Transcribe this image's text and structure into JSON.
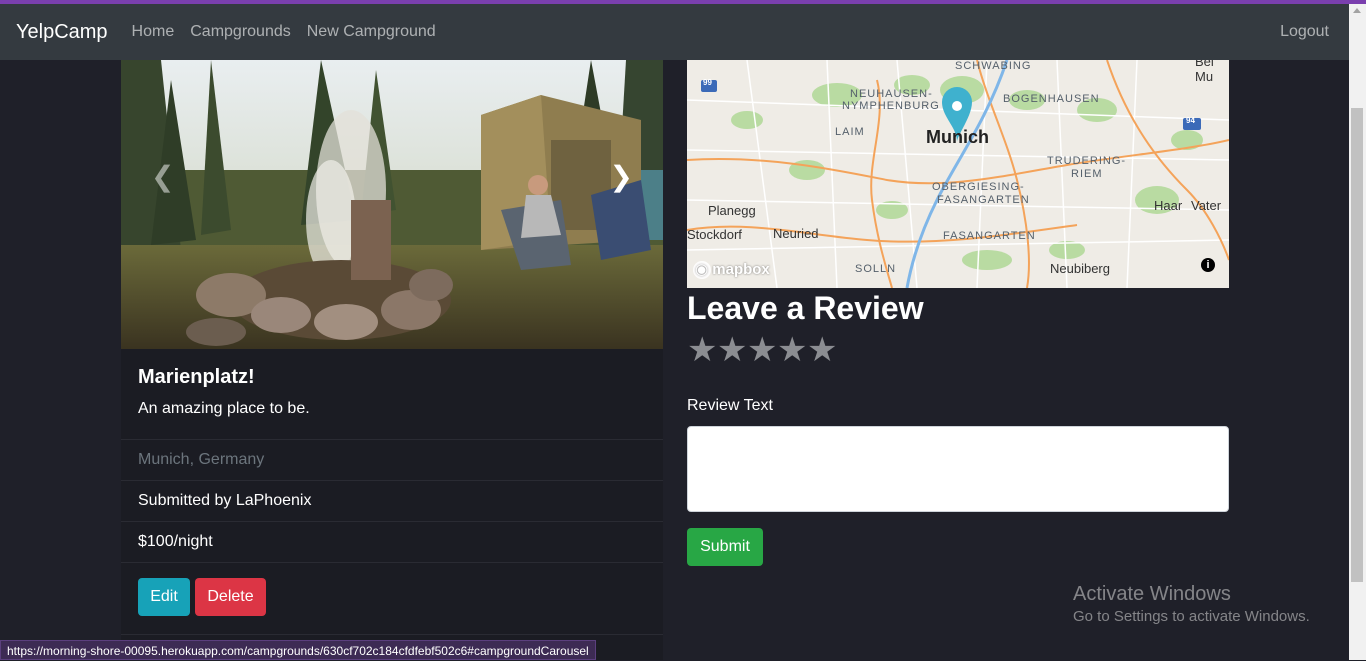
{
  "browser": {
    "status_url": "https://morning-shore-00095.herokuapp.com/campgrounds/630cf702c184cfdfebf502c6#campgroundCarousel"
  },
  "navbar": {
    "brand": "YelpCamp",
    "links": [
      "Home",
      "Campgrounds",
      "New Campground"
    ],
    "logout": "Logout"
  },
  "campground": {
    "title": "Marienplatz!",
    "description": "An amazing place to be.",
    "location": "Munich, Germany",
    "submitted_by": "Submitted by LaPhoenix",
    "price": "$100/night",
    "edit_label": "Edit",
    "delete_label": "Delete"
  },
  "map": {
    "city": "Munich",
    "districts": [
      "SCHWABING",
      "NEUHAUSEN-",
      "NYMPHENBURG",
      "BOGENHAUSEN",
      "LAIM",
      "TRUDERING-",
      "RIEM",
      "OBERGIESING-",
      "FASANGARTEN",
      "FASANGARTEN",
      "SOLLN"
    ],
    "towns": [
      "Planegg",
      "Neuried",
      "Stockdorf",
      "Haar",
      "Vater",
      "Neubiberg",
      "Bei Mu"
    ],
    "road_shields": [
      "99",
      "94"
    ],
    "attribution": "mapbox",
    "info_icon": "i"
  },
  "review": {
    "heading": "Leave a Review",
    "rating_stars": 5,
    "rating_selected": 0,
    "text_label": "Review Text",
    "text_value": "",
    "submit_label": "Submit"
  },
  "watermark": {
    "title": "Activate Windows",
    "subtitle": "Go to Settings to activate Windows."
  },
  "colors": {
    "navbar": "#343a40",
    "edit": "#17a2b8",
    "delete": "#dc3545",
    "submit": "#28a745"
  }
}
